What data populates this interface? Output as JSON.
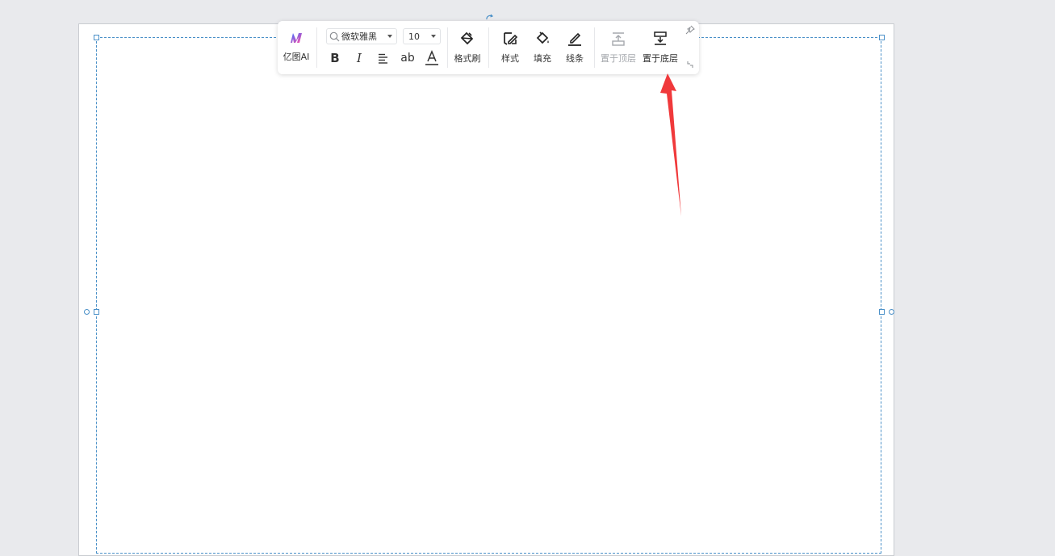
{
  "toolbar": {
    "ai": {
      "label": "亿图AI"
    },
    "font_family": {
      "value": "微软雅黑"
    },
    "font_size": {
      "value": "10"
    },
    "format_buttons": {
      "bold": "B",
      "italic": "I",
      "text_wrap": "ab"
    },
    "format_painter": {
      "label": "格式刷"
    },
    "style": {
      "label": "样式"
    },
    "fill": {
      "label": "填充"
    },
    "line": {
      "label": "线条"
    },
    "bring_to_front": {
      "label": "置于顶层",
      "disabled": true
    },
    "send_to_back": {
      "label": "置于底层"
    }
  },
  "colors": {
    "canvas_bg": "#e9eaed",
    "selection": "#4a90c8",
    "annotation_arrow": "#f0393b",
    "ai_gradient_start": "#3d6cff",
    "ai_gradient_end": "#ff4fa8"
  },
  "icons": {
    "ai": "yitu-ai-icon",
    "search": "search-icon",
    "align": "align-left-icon",
    "font_color": "font-color-icon",
    "painter": "format-painter-icon",
    "style": "style-icon",
    "fill": "paint-bucket-icon",
    "line": "line-pen-icon",
    "front": "bring-to-front-icon",
    "back": "send-to-back-icon",
    "pin": "pin-icon"
  }
}
